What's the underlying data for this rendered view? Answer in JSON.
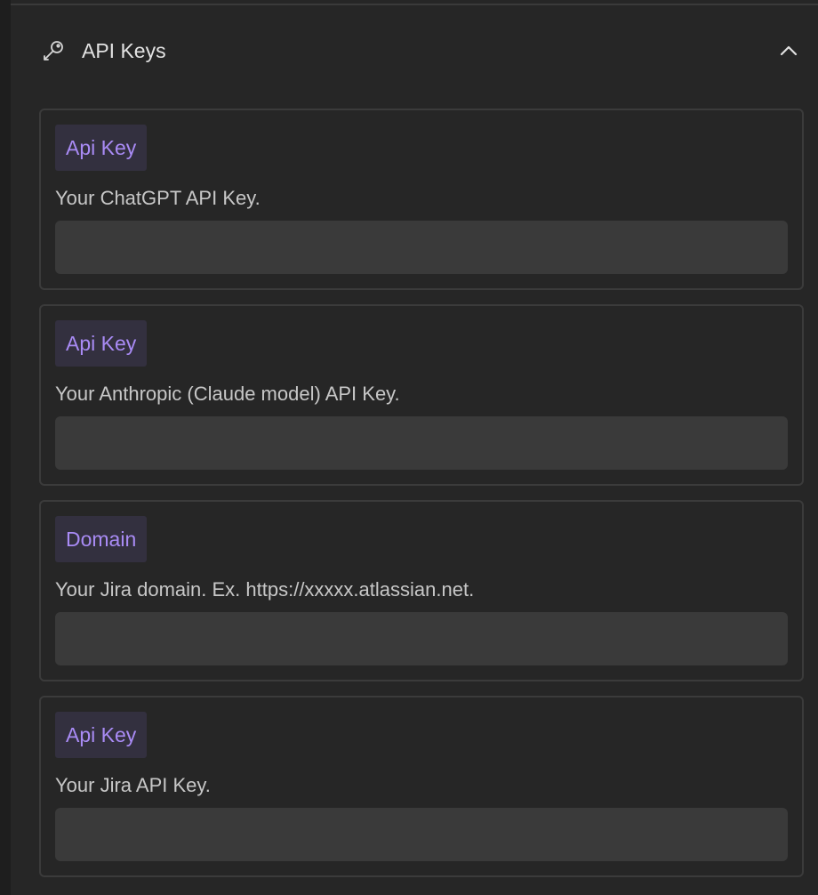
{
  "section": {
    "title": "API Keys",
    "icon": "key-icon",
    "collapse_icon": "chevron-up-icon"
  },
  "colors": {
    "background": "#262626",
    "card_border": "#3b3b3b",
    "badge_bg": "#33303f",
    "badge_text": "#a98bf5",
    "input_bg": "#3a3a3a"
  },
  "settings": [
    {
      "badge": "Api Key",
      "description": "Your ChatGPT API Key.",
      "value": "",
      "placeholder": ""
    },
    {
      "badge": "Api Key",
      "description": "Your Anthropic (Claude model) API Key.",
      "value": "",
      "placeholder": ""
    },
    {
      "badge": "Domain",
      "description": "Your Jira domain. Ex. https://xxxxx.atlassian.net.",
      "value": "",
      "placeholder": ""
    },
    {
      "badge": "Api Key",
      "description": "Your Jira API Key.",
      "value": "",
      "placeholder": ""
    }
  ]
}
